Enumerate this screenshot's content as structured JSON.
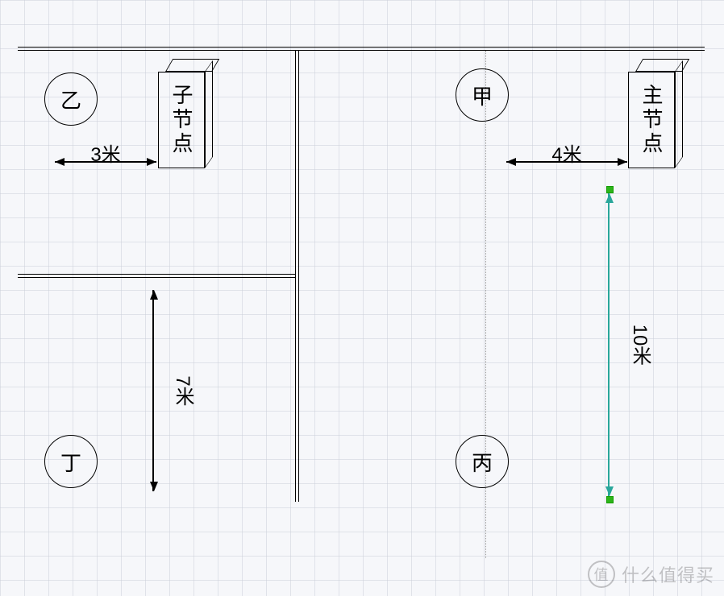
{
  "nodes": {
    "jia": "甲",
    "yi": "乙",
    "bing": "丙",
    "ding": "丁",
    "main_node": "主节点",
    "child_node": "子节点"
  },
  "dimensions": {
    "yi_to_child": {
      "value": 3,
      "label": "3米"
    },
    "jia_to_main": {
      "value": 4,
      "label": "4米"
    },
    "vertical_7": {
      "value": 7,
      "label": "7米"
    },
    "vertical_10": {
      "value": 10,
      "label": "10米"
    }
  },
  "watermark": {
    "badge": "值",
    "text": "什么值得买"
  }
}
